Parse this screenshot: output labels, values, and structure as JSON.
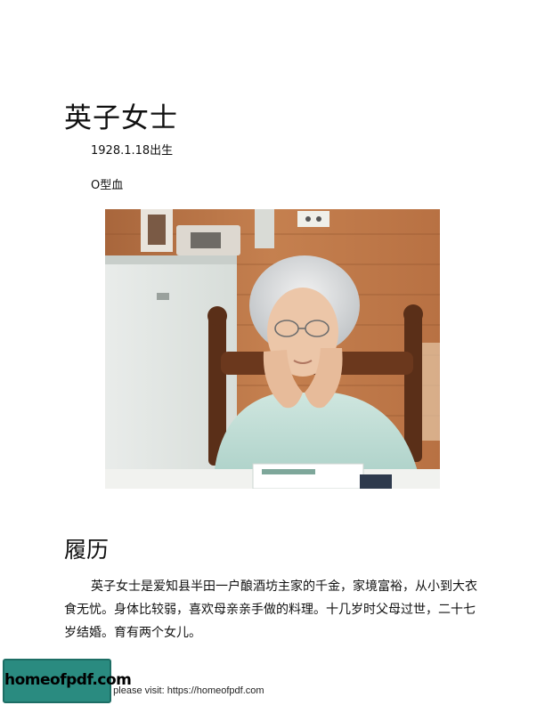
{
  "page": {
    "title": "英子女士",
    "birth": "1928.1.18出生",
    "blood_type": "O型血"
  },
  "photo": {
    "description_icon": "elderly-woman-portrait"
  },
  "biography": {
    "heading": "履历",
    "paragraph": "英子女士是爱知县半田一户酿酒坊主家的千金，家境富裕，从小到大衣食无忧。身体比较弱，喜欢母亲亲手做的料理。十几岁时父母过世，二十七岁结婚。育有两个女儿。"
  },
  "watermark": {
    "badge": "homeofpdf.com",
    "note": "e please visit: https://homeofpdf.com"
  }
}
